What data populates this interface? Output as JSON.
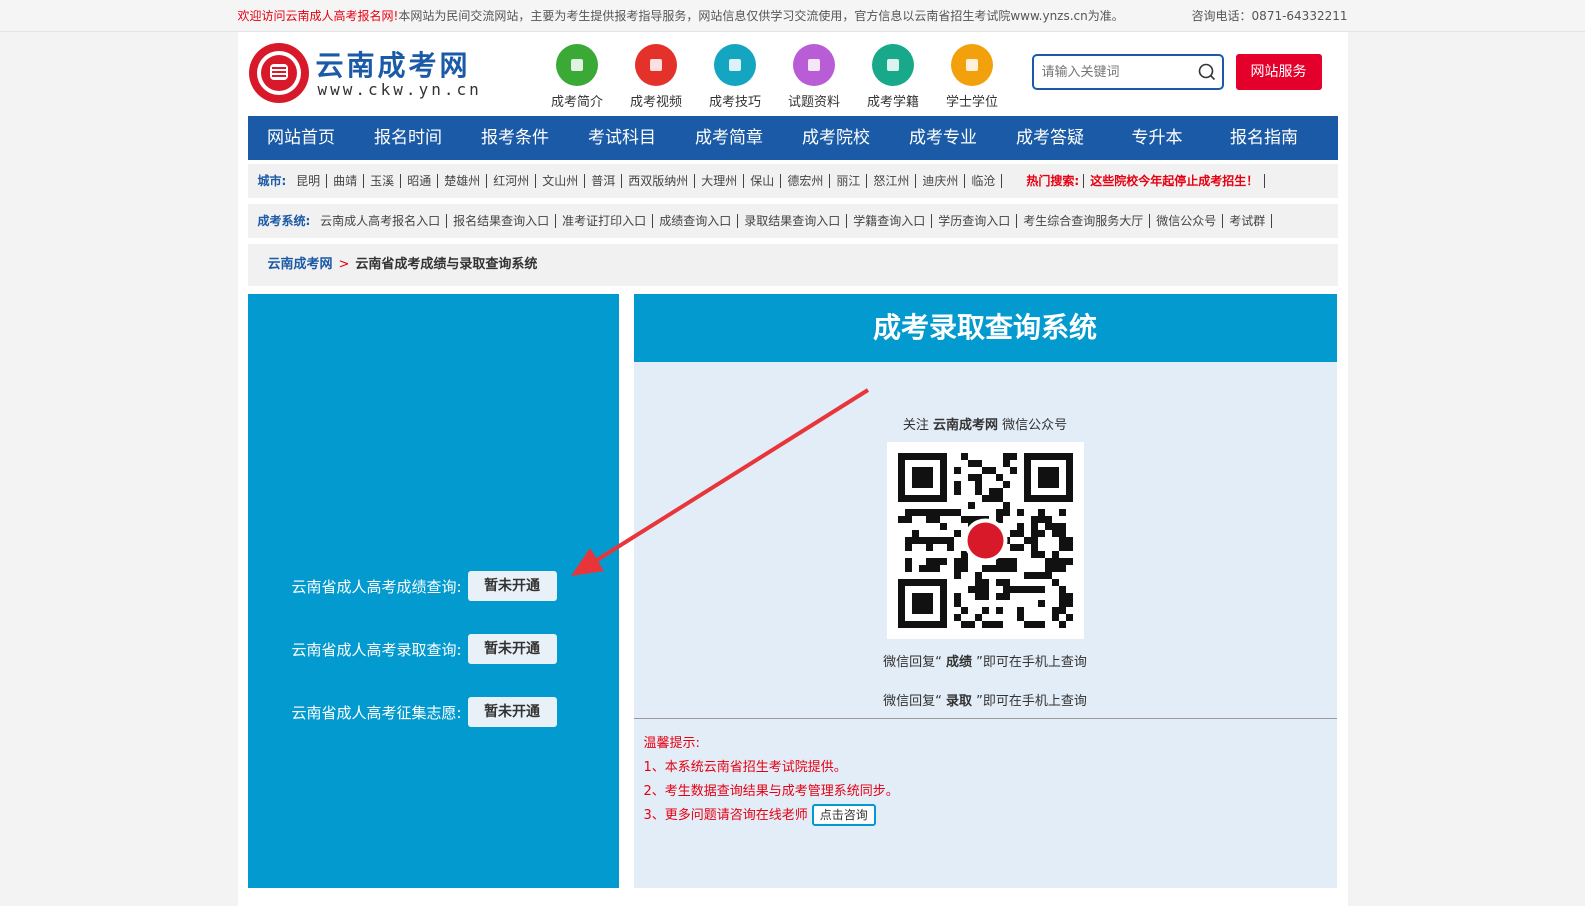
{
  "topbar": {
    "welcome": "欢迎访问云南成人高考报名网!",
    "notice": "本网站为民间交流网站，主要为考生提供报考指导服务，网站信息仅供学习交流使用，官方信息以云南省招生考试院www.ynzs.cn为准。",
    "phone": "咨询电话：0871-64332211"
  },
  "logo": {
    "name": "云南成考网",
    "url": "www.ckw.yn.cn"
  },
  "quick_links": [
    {
      "label": "成考简介",
      "color": "#3aa935",
      "icon": "building-icon"
    },
    {
      "label": "成考视频",
      "color": "#e4322b",
      "icon": "monitor-icon"
    },
    {
      "label": "成考技巧",
      "color": "#14a5c0",
      "icon": "flask-icon"
    },
    {
      "label": "试题资料",
      "color": "#b95dd6",
      "icon": "binoculars-icon"
    },
    {
      "label": "成考学籍",
      "color": "#18a88a",
      "icon": "clipboard-icon"
    },
    {
      "label": "学士学位",
      "color": "#f2a10c",
      "icon": "certificate-icon"
    }
  ],
  "search": {
    "placeholder": "请输入关键词",
    "service_button": "网站服务"
  },
  "nav": [
    "网站首页",
    "报名时间",
    "报考条件",
    "考试科目",
    "成考简章",
    "成考院校",
    "成考专业",
    "成考答疑",
    "专升本",
    "报名指南"
  ],
  "cities": {
    "label": "城市:",
    "items": [
      "昆明",
      "曲靖",
      "玉溪",
      "昭通",
      "楚雄州",
      "红河州",
      "文山州",
      "普洱",
      "西双版纳州",
      "大理州",
      "保山",
      "德宏州",
      "丽江",
      "怒江州",
      "迪庆州",
      "临沧"
    ],
    "hot_label": "热门搜索:",
    "hot_link": "这些院校今年起停止成考招生！"
  },
  "systems": {
    "label": "成考系统:",
    "items": [
      "云南成人高考报名入口",
      "报名结果查询入口",
      "准考证打印入口",
      "成绩查询入口",
      "录取结果查询入口",
      "学籍查询入口",
      "学历查询入口",
      "考生综合查询服务大厅",
      "微信公众号",
      "考试群"
    ]
  },
  "breadcrumb": {
    "home": "云南成考网",
    "sep": ">",
    "current": "云南省成考成绩与录取查询系统"
  },
  "queries": [
    {
      "label": "云南省成人高考成绩查询:",
      "button": "暂未开通"
    },
    {
      "label": "云南省成人高考录取查询:",
      "button": "暂未开通"
    },
    {
      "label": "云南省成人高考征集志愿:",
      "button": "暂未开通"
    }
  ],
  "right": {
    "title": "成考录取查询系统",
    "follow_prefix": "关注 ",
    "follow_name": "云南成考网",
    "follow_suffix": " 微信公众号",
    "reply1": {
      "prefix": "微信回复“ ",
      "keyword": "成绩",
      "suffix": " ”即可在手机上查询"
    },
    "reply2": {
      "prefix": "微信回复“ ",
      "keyword": "录取",
      "suffix": " ”即可在手机上查询"
    },
    "tips_title": "温馨提示:",
    "tips": [
      "1、本系统云南省招生考试院提供。",
      "2、考生数据查询结果与成考管理系统同步。",
      "3、更多问题请咨询在线老师"
    ],
    "consult_button": "点击咨询"
  },
  "colors": {
    "brand_blue": "#1b5aa6",
    "panel_blue": "#039bcf",
    "red": "#e60012",
    "light_panel": "#e3edf7"
  }
}
